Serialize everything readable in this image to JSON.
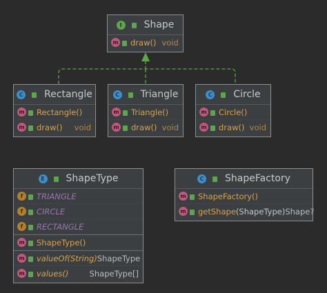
{
  "diagram": {
    "shape": {
      "name": "Shape",
      "badge": "I",
      "members": [
        {
          "name": "draw()",
          "type": "void",
          "badge": "m"
        }
      ]
    },
    "rectangle": {
      "name": "Rectangle",
      "badge": "C",
      "members": [
        {
          "name": "Rectangle()",
          "badge": "m"
        },
        {
          "name": "draw()",
          "type": "void",
          "badge": "m"
        }
      ]
    },
    "triangle": {
      "name": "Triangle",
      "badge": "C",
      "members": [
        {
          "name": "Triangle()",
          "badge": "m"
        },
        {
          "name": "draw()",
          "type": "void",
          "badge": "m"
        }
      ]
    },
    "circle": {
      "name": "Circle",
      "badge": "C",
      "members": [
        {
          "name": "Circle()",
          "badge": "m"
        },
        {
          "name": "draw()",
          "type": "void",
          "badge": "m"
        }
      ]
    },
    "shapetype": {
      "name": "ShapeType",
      "badge": "E",
      "fields": [
        {
          "name": "TRIANGLE",
          "badge": "f"
        },
        {
          "name": "CIRCLE",
          "badge": "f"
        },
        {
          "name": "RECTANGLE",
          "badge": "f"
        }
      ],
      "constructor": {
        "name": "ShapeType()",
        "badge": "m"
      },
      "methods": [
        {
          "name": "valueOf",
          "args": "(String)",
          "type": "ShapeType",
          "badge": "m"
        },
        {
          "name": "values",
          "args": "()",
          "type": "ShapeType[]",
          "badge": "m"
        }
      ]
    },
    "shapefactory": {
      "name": "ShapeFactory",
      "badge": "C",
      "members": [
        {
          "name": "ShapeFactory()",
          "badge": "m"
        },
        {
          "name": "getShape",
          "args": "(ShapeType)",
          "type": "Shape?",
          "badge": "m"
        }
      ]
    }
  },
  "colors": {
    "background": "#2b2b2b",
    "box": "#3c3f41",
    "arrow": "#5ea54d",
    "method_text": "#d7a24c"
  }
}
